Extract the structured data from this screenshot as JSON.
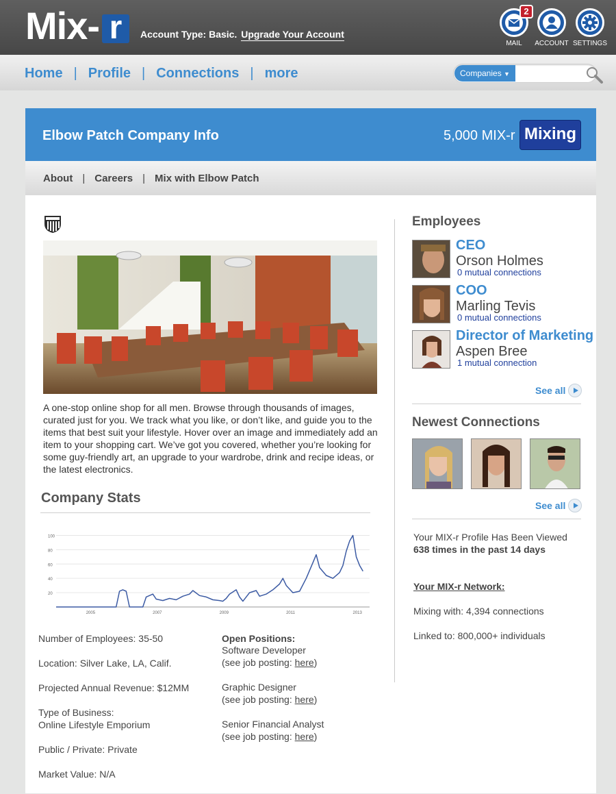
{
  "header": {
    "logo_text": "Mix-",
    "logo_box_text": "r",
    "account_type": "Account Type: Basic.",
    "upgrade_link": "Upgrade Your Account",
    "mail_label": "MAIL",
    "mail_badge": "2",
    "account_label": "ACCOUNT",
    "settings_label": "SETTINGS"
  },
  "nav": {
    "items": [
      "Home",
      "Profile",
      "Connections",
      "more"
    ],
    "separator": "|"
  },
  "search": {
    "dropdown_value": "Companies",
    "placeholder": ""
  },
  "company": {
    "title": "Elbow Patch Company Info",
    "points": "5,000 MIX-r",
    "mixing_button": "Mixing",
    "tabs": [
      "About",
      "Careers",
      "Mix with Elbow Patch"
    ],
    "description": "A one-stop online shop for all men. Browse through thousands of images, curated just for you. We track what you like, or don’t like, and guide you to the items that best suit your lifestyle. Hover over an image and immediately add an item to your shopping cart. We’ve got you covered, whether you’re looking for some guy-friendly art, an upgrade to your wardrobe, drink and recipe ideas, or the latest electronics."
  },
  "stats": {
    "title": "Company Stats",
    "facts": {
      "employees": "Number of Employees: 35-50",
      "location": "Location: Silver Lake, LA, Calif.",
      "revenue": "Projected Annual Revenue: $12MM",
      "type_label": "Type of Business:",
      "type_value": "Online Lifestyle Emporium",
      "public_private": "Public / Private: Private",
      "market_value": "Market Value: N/A"
    },
    "open_positions_title": "Open Positions:",
    "positions": [
      {
        "title": "Software Developer",
        "note": "(see job posting: ",
        "link": "here",
        "close": ")"
      },
      {
        "title": "Graphic Designer",
        "note": "(see job posting: ",
        "link": "here",
        "close": ")"
      },
      {
        "title": "Senior Financial Analyst",
        "note": "(see job posting: ",
        "link": "here",
        "close": ")"
      }
    ]
  },
  "chart_data": {
    "type": "line",
    "title": "",
    "xlabel": "",
    "ylabel": "",
    "xlim": [
      2004,
      2013.4
    ],
    "ylim": [
      0,
      110
    ],
    "yticks": [
      "100",
      "80",
      "60",
      "40",
      "20"
    ],
    "ytick_values": [
      100,
      80,
      60,
      40,
      20
    ],
    "xticks": [
      "2005",
      "2007",
      "2009",
      "2011",
      "2013"
    ],
    "xtick_values": [
      2005,
      2007,
      2009,
      2011,
      2013
    ],
    "grid": true,
    "series": [
      {
        "name": "",
        "color": "#3b5aa3",
        "points": [
          [
            2004.0,
            0
          ],
          [
            2005.2,
            0
          ],
          [
            2005.8,
            0
          ],
          [
            2005.9,
            22
          ],
          [
            2006.0,
            24
          ],
          [
            2006.1,
            22
          ],
          [
            2006.2,
            0
          ],
          [
            2006.6,
            0
          ],
          [
            2006.7,
            14
          ],
          [
            2006.9,
            18
          ],
          [
            2007.0,
            11
          ],
          [
            2007.2,
            9
          ],
          [
            2007.4,
            12
          ],
          [
            2007.6,
            10
          ],
          [
            2007.8,
            15
          ],
          [
            2008.0,
            18
          ],
          [
            2008.1,
            23
          ],
          [
            2008.3,
            16
          ],
          [
            2008.5,
            14
          ],
          [
            2008.7,
            10
          ],
          [
            2008.9,
            9
          ],
          [
            2009.0,
            8
          ],
          [
            2009.1,
            12
          ],
          [
            2009.2,
            18
          ],
          [
            2009.4,
            24
          ],
          [
            2009.5,
            14
          ],
          [
            2009.6,
            8
          ],
          [
            2009.7,
            14
          ],
          [
            2009.8,
            20
          ],
          [
            2010.0,
            23
          ],
          [
            2010.1,
            15
          ],
          [
            2010.3,
            18
          ],
          [
            2010.5,
            24
          ],
          [
            2010.7,
            32
          ],
          [
            2010.8,
            40
          ],
          [
            2010.9,
            30
          ],
          [
            2011.1,
            20
          ],
          [
            2011.3,
            22
          ],
          [
            2011.5,
            40
          ],
          [
            2011.7,
            62
          ],
          [
            2011.8,
            73
          ],
          [
            2011.9,
            55
          ],
          [
            2012.1,
            44
          ],
          [
            2012.3,
            40
          ],
          [
            2012.5,
            48
          ],
          [
            2012.6,
            58
          ],
          [
            2012.7,
            78
          ],
          [
            2012.8,
            92
          ],
          [
            2012.9,
            100
          ],
          [
            2013.0,
            70
          ],
          [
            2013.1,
            58
          ],
          [
            2013.2,
            50
          ]
        ]
      }
    ]
  },
  "employees": {
    "title": "Employees",
    "list": [
      {
        "role": "CEO",
        "name": "Orson Holmes",
        "mutual": "0 mutual connections"
      },
      {
        "role": "COO",
        "name": "Marling Tevis",
        "mutual": "0 mutual connections"
      },
      {
        "role": "Director of Marketing",
        "name": "Aspen Bree",
        "mutual": "1 mutual connection"
      }
    ],
    "see_all": "See all"
  },
  "newest": {
    "title": "Newest Connections",
    "see_all": "See all"
  },
  "profile_views": {
    "line1": "Your MIX-r Profile Has Been Viewed",
    "line2": "638 times in the past 14 days"
  },
  "network": {
    "title": "Your MIX-r Network:",
    "mixing": "Mixing with: 4,394 connections",
    "linked": "Linked to: 800,000+ individuals"
  },
  "colors": {
    "accent_blue": "#3e8ccf",
    "dark_blue": "#1f3f9c",
    "badge_red": "#c3202d"
  }
}
